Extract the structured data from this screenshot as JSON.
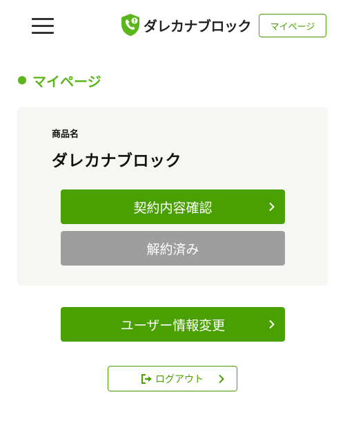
{
  "header": {
    "logo_text": "ダレカナブロック",
    "mypage_label": "マイページ"
  },
  "section": {
    "title": "マイページ"
  },
  "product": {
    "label": "商品名",
    "name": "ダレカナブロック",
    "contract_button": "契約内容確認",
    "cancel_button": "解約済み"
  },
  "actions": {
    "user_info_button": "ユーザー情報変更",
    "logout_button": "ログアウト"
  },
  "colors": {
    "primary_green": "#4aa000",
    "title_green": "#5bb61c",
    "disabled_gray": "#9e9e9e"
  },
  "icons": {
    "menu": "hamburger-icon",
    "logo": "shield-phone-icon",
    "chevron": "chevron-right-icon",
    "logout": "logout-icon"
  }
}
